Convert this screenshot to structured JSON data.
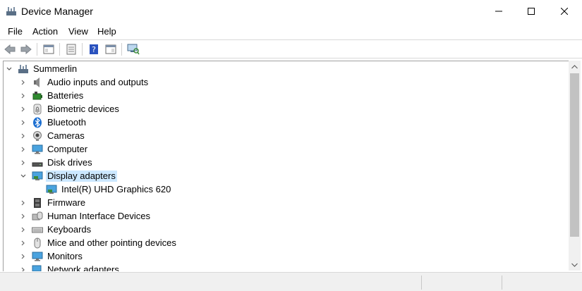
{
  "window": {
    "title": "Device Manager"
  },
  "menu": {
    "items": [
      "File",
      "Action",
      "View",
      "Help"
    ]
  },
  "tree": {
    "root": "Summerlin",
    "categories": [
      {
        "label": "Audio inputs and outputs",
        "icon": "speaker-icon",
        "expanded": false
      },
      {
        "label": "Batteries",
        "icon": "battery-icon",
        "expanded": false
      },
      {
        "label": "Biometric devices",
        "icon": "fingerprint-icon",
        "expanded": false
      },
      {
        "label": "Bluetooth",
        "icon": "bluetooth-icon",
        "expanded": false
      },
      {
        "label": "Cameras",
        "icon": "camera-icon",
        "expanded": false
      },
      {
        "label": "Computer",
        "icon": "computer-icon",
        "expanded": false
      },
      {
        "label": "Disk drives",
        "icon": "disk-drive-icon",
        "expanded": false
      },
      {
        "label": "Display adapters",
        "icon": "display-adapter-icon",
        "expanded": true,
        "selected": true
      },
      {
        "label": "Intel(R) UHD Graphics 620",
        "icon": "display-adapter-icon",
        "child": true
      },
      {
        "label": "Firmware",
        "icon": "firmware-icon",
        "expanded": false
      },
      {
        "label": "Human Interface Devices",
        "icon": "hid-icon",
        "expanded": false
      },
      {
        "label": "Keyboards",
        "icon": "keyboard-icon",
        "expanded": false
      },
      {
        "label": "Mice and other pointing devices",
        "icon": "mouse-icon",
        "expanded": false
      },
      {
        "label": "Monitors",
        "icon": "monitor-icon",
        "expanded": false
      },
      {
        "label": "Network adapters",
        "icon": "network-adapter-icon",
        "expanded": false
      }
    ]
  },
  "colors": {
    "selection": "#cce8ff",
    "accent": "#0078d7"
  }
}
